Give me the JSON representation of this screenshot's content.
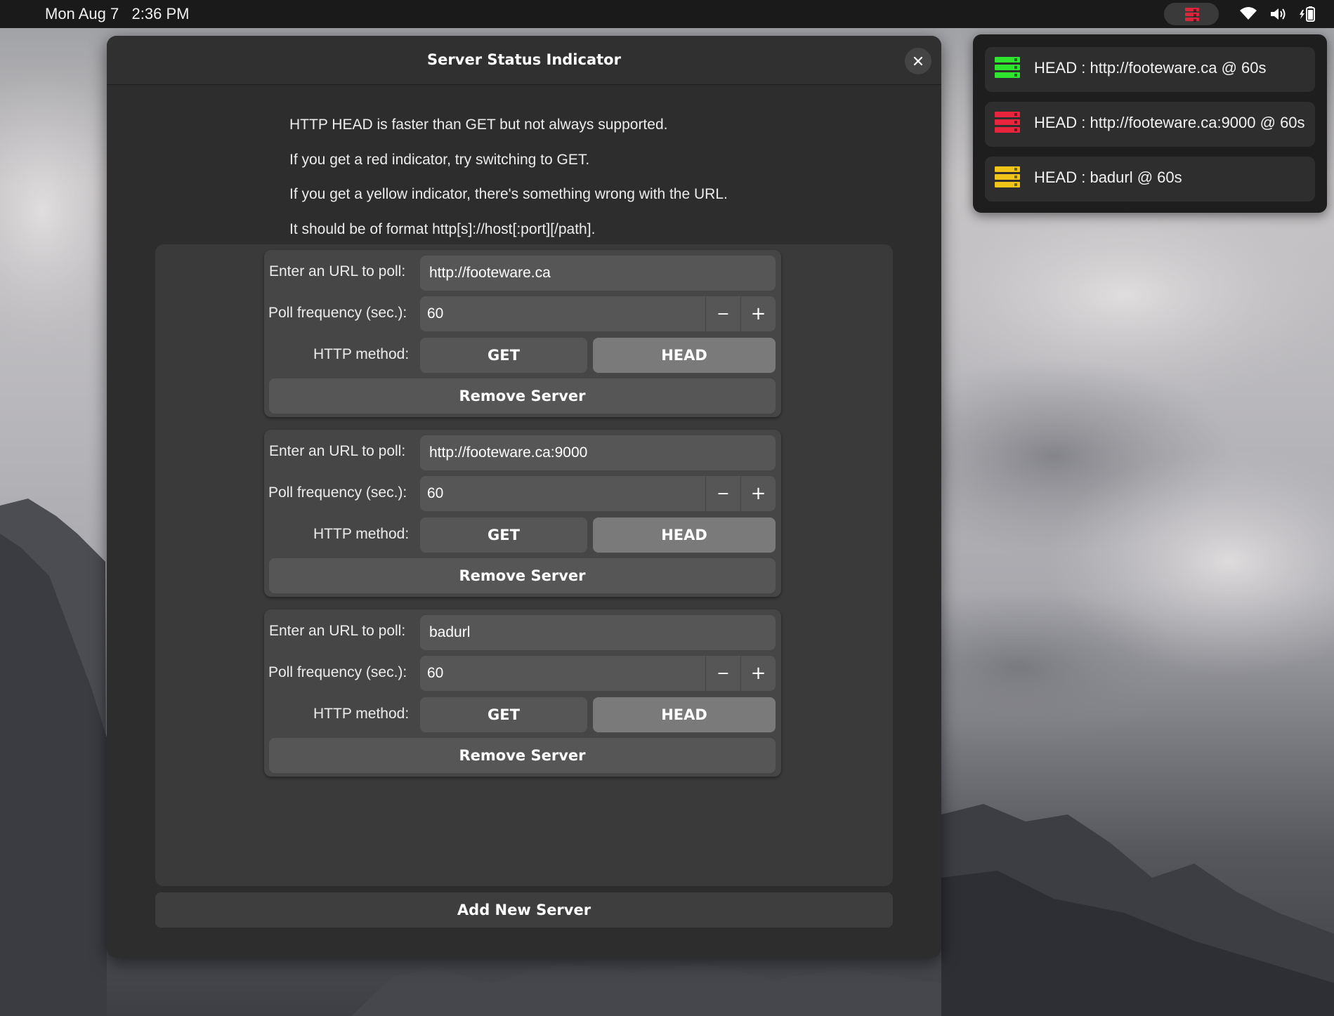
{
  "topbar": {
    "date": "Mon Aug 7",
    "time": "2:36 PM",
    "indicator_icon": "server-status-icon",
    "indicator_color": "#d9263a",
    "tray_icons": [
      "wifi-icon",
      "volume-icon",
      "battery-icon"
    ]
  },
  "dialog": {
    "title": "Server Status Indicator",
    "close_icon": "close-icon",
    "help_lines": [
      "HTTP HEAD is faster than GET but not always supported.",
      "If you get a red indicator, try switching to GET.",
      "If you get a yellow indicator, there's something wrong with the URL.",
      "It should be of format http[s]://host[:port][/path]."
    ],
    "servers": [
      {
        "url_label": "Enter an URL to poll:",
        "url": "http://footeware.ca",
        "freq_label": "Poll frequency (sec.):",
        "freq": "60",
        "decrement": "−",
        "increment": "+",
        "method_label": "HTTP method:",
        "get_label": "GET",
        "head_label": "HEAD",
        "selected_method": "HEAD",
        "remove_label": "Remove Server"
      },
      {
        "url_label": "Enter an URL to poll:",
        "url": "http://footeware.ca:9000",
        "freq_label": "Poll frequency (sec.):",
        "freq": "60",
        "decrement": "−",
        "increment": "+",
        "method_label": "HTTP method:",
        "get_label": "GET",
        "head_label": "HEAD",
        "selected_method": "HEAD",
        "remove_label": "Remove Server"
      },
      {
        "url_label": "Enter an URL to poll:",
        "url": "badurl",
        "freq_label": "Poll frequency (sec.):",
        "freq": "60",
        "decrement": "−",
        "increment": "+",
        "method_label": "HTTP method:",
        "get_label": "GET",
        "head_label": "HEAD",
        "selected_method": "HEAD",
        "remove_label": "Remove Server"
      }
    ],
    "add_label": "Add New Server"
  },
  "menu": {
    "items": [
      {
        "label": "HEAD : http://footeware.ca @ 60s",
        "status_color": "#2ee62e",
        "icon": "server-status-icon"
      },
      {
        "label": "HEAD : http://footeware.ca:9000 @ 60s",
        "status_color": "#e8253c",
        "icon": "server-status-icon"
      },
      {
        "label": "HEAD : badurl @ 60s",
        "status_color": "#f0c419",
        "icon": "server-status-icon"
      }
    ]
  },
  "colors": {
    "dialog_bg": "#2d2d2d",
    "card_bg": "#464646",
    "selected_toggle": "#7a7a7a"
  }
}
